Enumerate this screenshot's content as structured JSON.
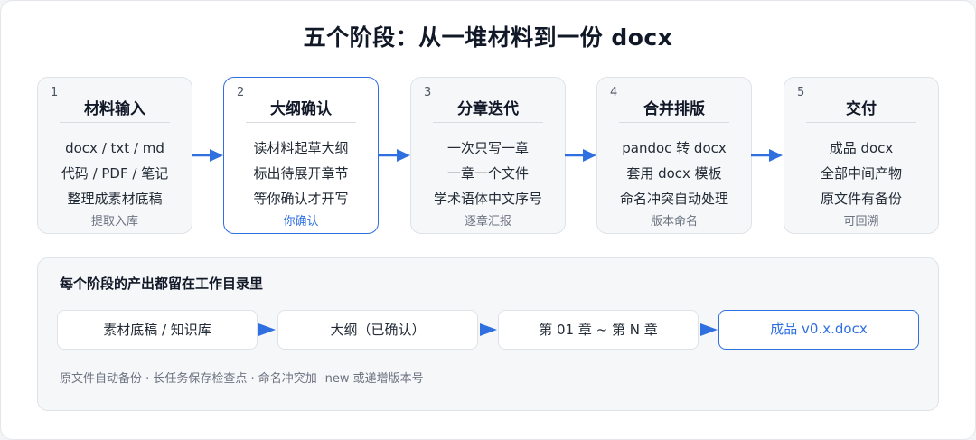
{
  "title": "五个阶段：从一堆材料到一份 docx",
  "colors": {
    "accent": "#2f6fe0",
    "arrow": "#2f6fe0"
  },
  "stages": [
    {
      "num": "1",
      "name": "材料输入",
      "lines": [
        "docx / txt / md",
        "代码 / PDF / 笔记",
        "整理成素材底稿"
      ],
      "note": "提取入库"
    },
    {
      "num": "2",
      "name": "大纲确认",
      "lines": [
        "读材料起草大纲",
        "标出待展开章节",
        "等你确认才开写"
      ],
      "note": "你确认"
    },
    {
      "num": "3",
      "name": "分章迭代",
      "lines": [
        "一次只写一章",
        "一章一个文件",
        "学术语体中文序号"
      ],
      "note": "逐章汇报"
    },
    {
      "num": "4",
      "name": "合并排版",
      "lines": [
        "pandoc 转 docx",
        "套用 docx 模板",
        "命名冲突自动处理"
      ],
      "note": "版本命名"
    },
    {
      "num": "5",
      "name": "交付",
      "lines": [
        "成品 docx",
        "全部中间产物",
        "原文件有备份"
      ],
      "note": "可回溯"
    }
  ],
  "outputs": {
    "title": "每个阶段的产出都留在工作目录里",
    "items": [
      "素材底稿 / 知识库",
      "大纲（已确认）",
      "第 01 章 ~ 第 N 章",
      "成品 v0.x.docx"
    ],
    "footnote": "原文件自动备份 · 长任务保存检查点 · 命名冲突加 -new 或递增版本号"
  }
}
